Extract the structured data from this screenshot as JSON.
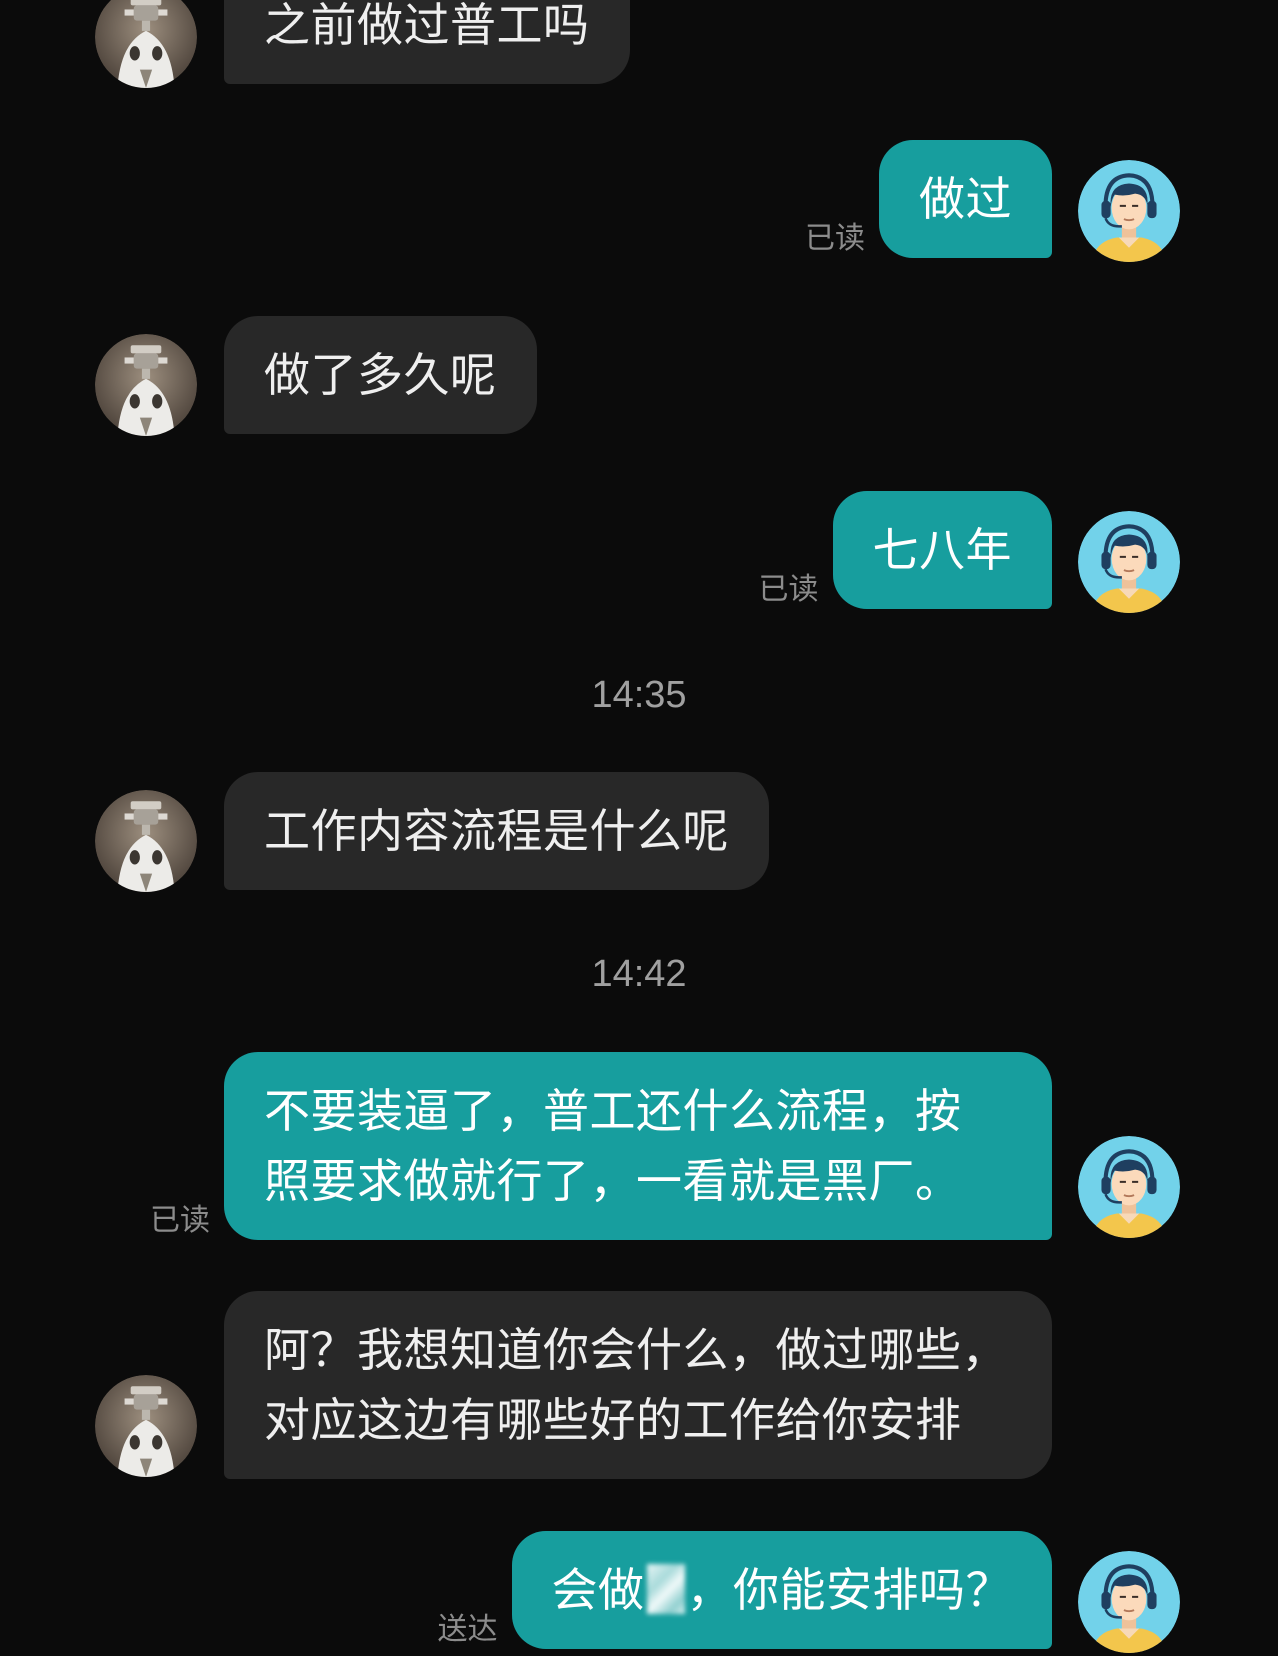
{
  "theme": {
    "background": "#0b0b0b",
    "incoming_bubble": "#282828",
    "outgoing_bubble": "#179e9e",
    "incoming_text": "#efefef",
    "outgoing_text": "#ffffff",
    "status_text": "#8c8c8c",
    "timestamp_text": "#a0a0a0"
  },
  "chat": {
    "incoming_avatar_icon": "robot-avatar-icon",
    "outgoing_avatar_icon": "headset-avatar-icon",
    "messages": [
      {
        "lines": [
          "之前做过普工吗"
        ]
      },
      {
        "lines": [
          "做过"
        ],
        "status": "已读"
      },
      {
        "lines": [
          "做了多久呢"
        ]
      },
      {
        "lines": [
          "七八年"
        ],
        "status": "已读"
      },
      {
        "time": "14:35"
      },
      {
        "lines": [
          "工作内容流程是什么呢"
        ]
      },
      {
        "time": "14:42"
      },
      {
        "lines": [
          "不要装逼了，普工还什么流程，按",
          "照要求做就行了，一看就是黑厂。"
        ],
        "status": "已读"
      },
      {
        "lines": [
          "阿？我想知道你会什么，做过哪些，",
          "对应这边有哪些好的工作给你安排"
        ]
      },
      {
        "text_parts": [
          "会做",
          "，你能安排吗？"
        ],
        "status": "送达"
      }
    ]
  }
}
